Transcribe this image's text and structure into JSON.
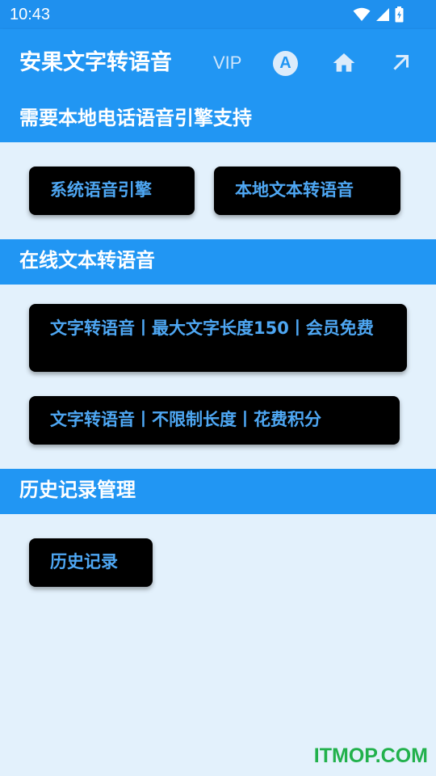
{
  "status_bar": {
    "time": "10:43"
  },
  "app_bar": {
    "title": "安果文字转语音",
    "vip_label": "VIP",
    "a_icon_letter": "A"
  },
  "sections": [
    {
      "title": "需要本地电话语音引擎支持",
      "buttons": [
        {
          "label": "系统语音引擎"
        },
        {
          "label": "本地文本转语音"
        }
      ]
    },
    {
      "title": "在线文本转语音",
      "buttons": [
        {
          "label": "文字转语音丨最大文字长度150丨会员免费"
        },
        {
          "label": "文字转语音丨不限制长度丨花费积分"
        }
      ]
    },
    {
      "title": "历史记录管理",
      "buttons": [
        {
          "label": "历史记录"
        }
      ]
    }
  ],
  "watermark": "ITMOP.COM",
  "colors": {
    "primary": "#2196f3",
    "status_bar": "#1f90ee",
    "background": "#e3f1fc",
    "button_bg": "#000000",
    "button_text": "#4ea7f3",
    "watermark": "#22b14c"
  }
}
